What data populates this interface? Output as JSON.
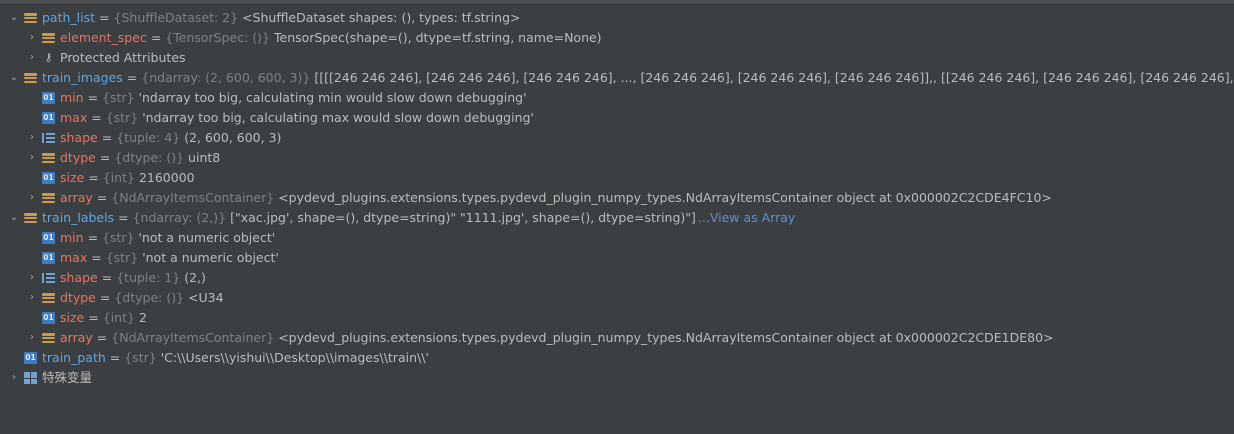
{
  "rows": [
    {
      "name": "path_list",
      "type": "{ShuffleDataset: 2}",
      "value": "<ShuffleDataset shapes: (), types: tf.string>"
    },
    {
      "name": "element_spec",
      "type": "{TensorSpec: ()}",
      "value": "TensorSpec(shape=(), dtype=tf.string, name=None)"
    },
    {
      "name": "Protected Attributes"
    },
    {
      "name": "train_images",
      "type": "{ndarray: (2, 600, 600, 3)}",
      "value": "[[[[246 246 246],    [246 246 246],    [246 246 246],    ...,    [246 246 246],    [246 246 246],    [246 246 246]],,  [[246 246 246],    [246 246 246],    [246 246 246],    ...,    [246 246 246],"
    },
    {
      "name": "min",
      "type": "{str}",
      "value": "'ndarray too big, calculating min would slow down debugging'"
    },
    {
      "name": "max",
      "type": "{str}",
      "value": "'ndarray too big, calculating max would slow down debugging'"
    },
    {
      "name": "shape",
      "type": "{tuple: 4}",
      "value": "(2, 600, 600, 3)"
    },
    {
      "name": "dtype",
      "type": "{dtype: ()}",
      "value": "uint8"
    },
    {
      "name": "size",
      "type": "{int}",
      "value": "2160000"
    },
    {
      "name": "array",
      "type": "{NdArrayItemsContainer}",
      "value": "<pydevd_plugins.extensions.types.pydevd_plugin_numpy_types.NdArrayItemsContainer object at 0x000002C2CDE4FC10>"
    },
    {
      "name": "train_labels",
      "type": "{ndarray: (2,)}",
      "value": "[\"xac.jpg', shape=(), dtype=string)\" \"1111.jpg', shape=(), dtype=string)\"]",
      "link": "...View as Array"
    },
    {
      "name": "min",
      "type": "{str}",
      "value": "'not a numeric object'"
    },
    {
      "name": "max",
      "type": "{str}",
      "value": "'not a numeric object'"
    },
    {
      "name": "shape",
      "type": "{tuple: 1}",
      "value": "(2,)"
    },
    {
      "name": "dtype",
      "type": "{dtype: ()}",
      "value": "<U34"
    },
    {
      "name": "size",
      "type": "{int}",
      "value": "2"
    },
    {
      "name": "array",
      "type": "{NdArrayItemsContainer}",
      "value": "<pydevd_plugins.extensions.types.pydevd_plugin_numpy_types.NdArrayItemsContainer object at 0x000002C2CDE1DE80>"
    },
    {
      "name": "train_path",
      "type": "{str}",
      "value": "'C:\\\\Users\\\\yishui\\\\Desktop\\\\images\\\\train\\\\'"
    },
    {
      "name": "特殊变量"
    }
  ],
  "glyphs": {
    "expanded": "⌄",
    "collapsed": "›",
    "key": "⚷"
  },
  "icon_labels": {
    "scalar": "01"
  },
  "colors": {
    "background": "#3c3f41",
    "name_red": "#e8735d",
    "name_blue": "#5aa7e6",
    "type_gray": "#808080",
    "link": "#5a8fd6",
    "struct_icon": "#d19a3a",
    "list_icon": "#6fa2d9"
  }
}
